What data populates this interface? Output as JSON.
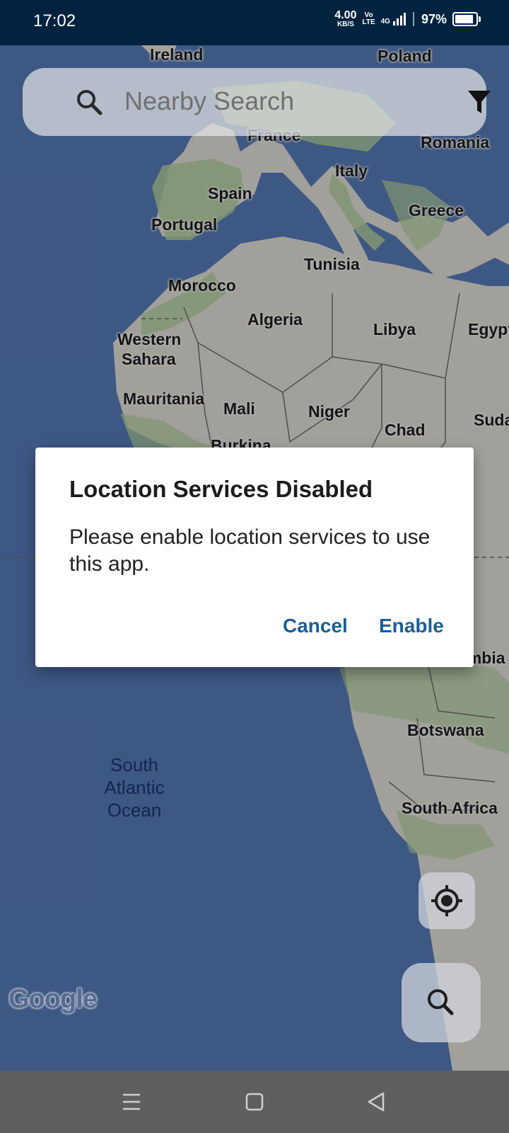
{
  "status_bar": {
    "time": "17:02",
    "net_speed_value": "4.00",
    "net_speed_unit": "KB/S",
    "volte_top": "Vo",
    "volte_bottom": "LTE",
    "network_type": "4G",
    "battery_percent_text": "97%",
    "battery_level": 0.97
  },
  "map": {
    "labels": [
      "Ireland",
      "Poland",
      "France",
      "Romania",
      "Italy",
      "Spain",
      "Greece",
      "Portugal",
      "Tunisia",
      "Morocco",
      "Algeria",
      "Libya",
      "Egypt",
      "Western",
      "Sahara",
      "Mauritania",
      "Mali",
      "Niger",
      "Chad",
      "Sudan",
      "Burkina",
      "Zambia",
      "Botswana",
      "South Africa"
    ],
    "ocean_label_lines": [
      "South",
      "Atlantic",
      "Ocean"
    ],
    "attribution": "Google",
    "colors": {
      "ocean": "#5a7fbd",
      "land": "#e9e6df",
      "vegetation": "#b7d6a3"
    }
  },
  "search": {
    "placeholder": "Nearby Search",
    "search_icon": "search-icon",
    "filter_icon": "filter-icon"
  },
  "dialog": {
    "title": "Location Services Disabled",
    "message": "Please enable location services to use this app.",
    "cancel_label": "Cancel",
    "enable_label": "Enable",
    "accent_color": "#1d5e96"
  },
  "fabs": {
    "locate_icon": "my-location-icon",
    "search_icon": "search-icon"
  },
  "nav_bar": {
    "buttons": [
      "menu-icon",
      "home-icon",
      "back-icon"
    ]
  }
}
